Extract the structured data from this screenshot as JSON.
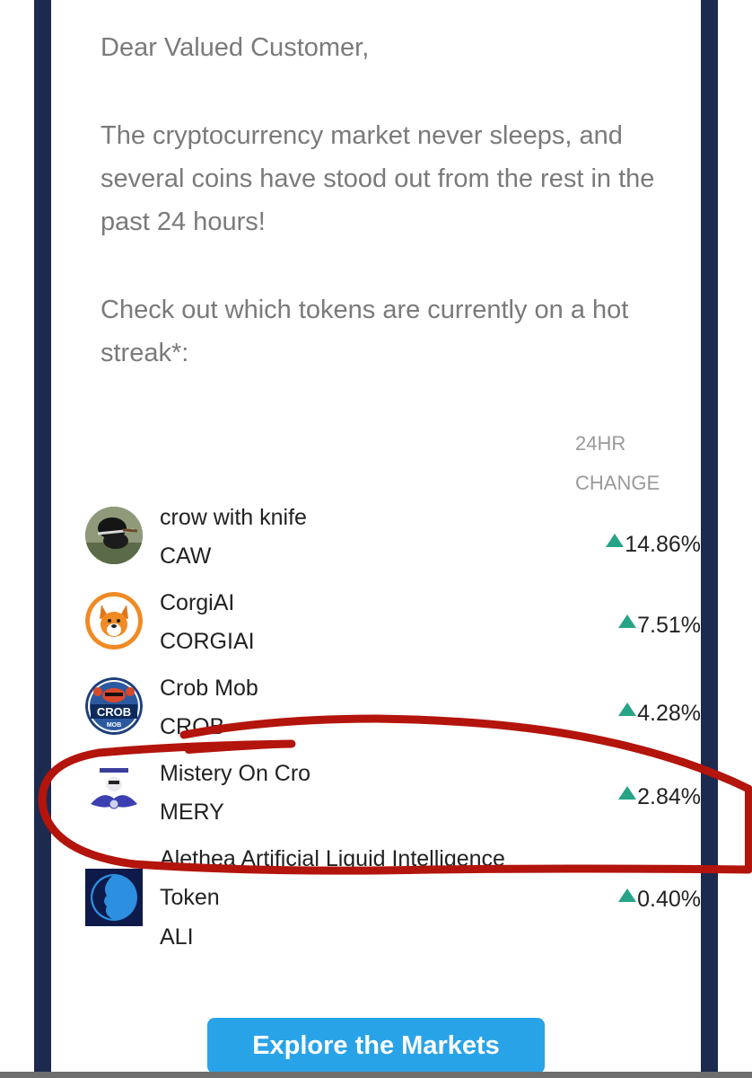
{
  "email": {
    "greeting": "Dear Valued Customer,",
    "intro": "The cryptocurrency market never sleeps, and several coins have stood out from the rest in the past 24 hours!",
    "prompt": "Check out which tokens are currently on a hot streak*:"
  },
  "table": {
    "header_line1": "24HR",
    "header_line2": "CHANGE",
    "rows": [
      {
        "name": "crow with knife",
        "symbol": "CAW",
        "change": "14.86%",
        "logo": "crow-logo"
      },
      {
        "name": "CorgiAI",
        "symbol": "CORGIAI",
        "change": "7.51%",
        "logo": "corgi-logo"
      },
      {
        "name": "Crob Mob",
        "symbol": "CROB",
        "change": "4.28%",
        "logo": "crob-logo",
        "logo_text": "CROB",
        "logo_subtext": "MOB"
      },
      {
        "name": "Mistery On Cro",
        "symbol": "MERY",
        "change": "2.84%",
        "logo": "mery-logo"
      },
      {
        "name": "Alethea Artificial Liquid Intelligence",
        "name_line2": "Token",
        "symbol": "ALI",
        "change": "0.40%",
        "logo": "ali-logo"
      }
    ]
  },
  "cta": {
    "label": "Explore the Markets"
  },
  "colors": {
    "border": "#1c2a4f",
    "text_gray": "#7a7a7a",
    "up_green": "#27a388",
    "cta_blue": "#29a3e8",
    "annotation_red": "#b3140c"
  }
}
